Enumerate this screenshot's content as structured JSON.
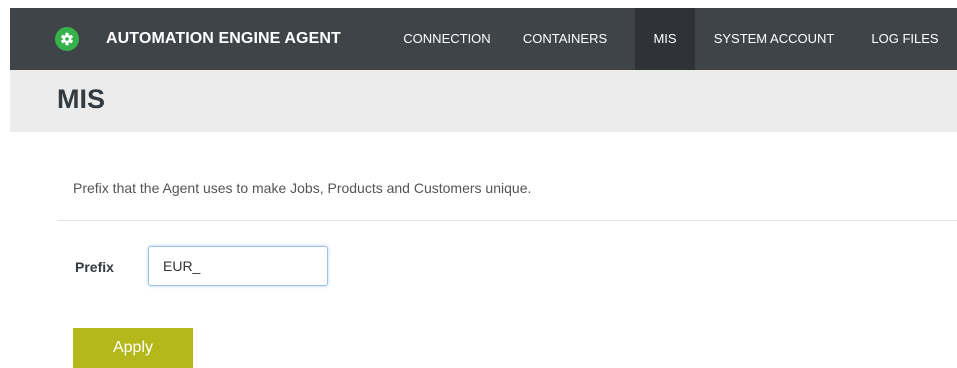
{
  "header": {
    "app_title": "AUTOMATION ENGINE AGENT",
    "logo_icon": "gear-icon",
    "nav": [
      {
        "label": "CONNECTION",
        "active": false
      },
      {
        "label": "CONTAINERS",
        "active": false
      },
      {
        "label": "MIS",
        "active": true
      },
      {
        "label": "SYSTEM ACCOUNT",
        "active": false
      },
      {
        "label": "LOG FILES",
        "active": false
      }
    ]
  },
  "page": {
    "title": "MIS",
    "description": "Prefix that the Agent uses to make Jobs, Products and Customers unique."
  },
  "form": {
    "prefix_label": "Prefix",
    "prefix_value": "EUR_",
    "apply_label": "Apply"
  },
  "colors": {
    "topbar": "#3f4449",
    "nav_active": "#2f3337",
    "logo": "#35b24a",
    "subheader": "#ececec",
    "apply_button": "#b4b81a"
  }
}
